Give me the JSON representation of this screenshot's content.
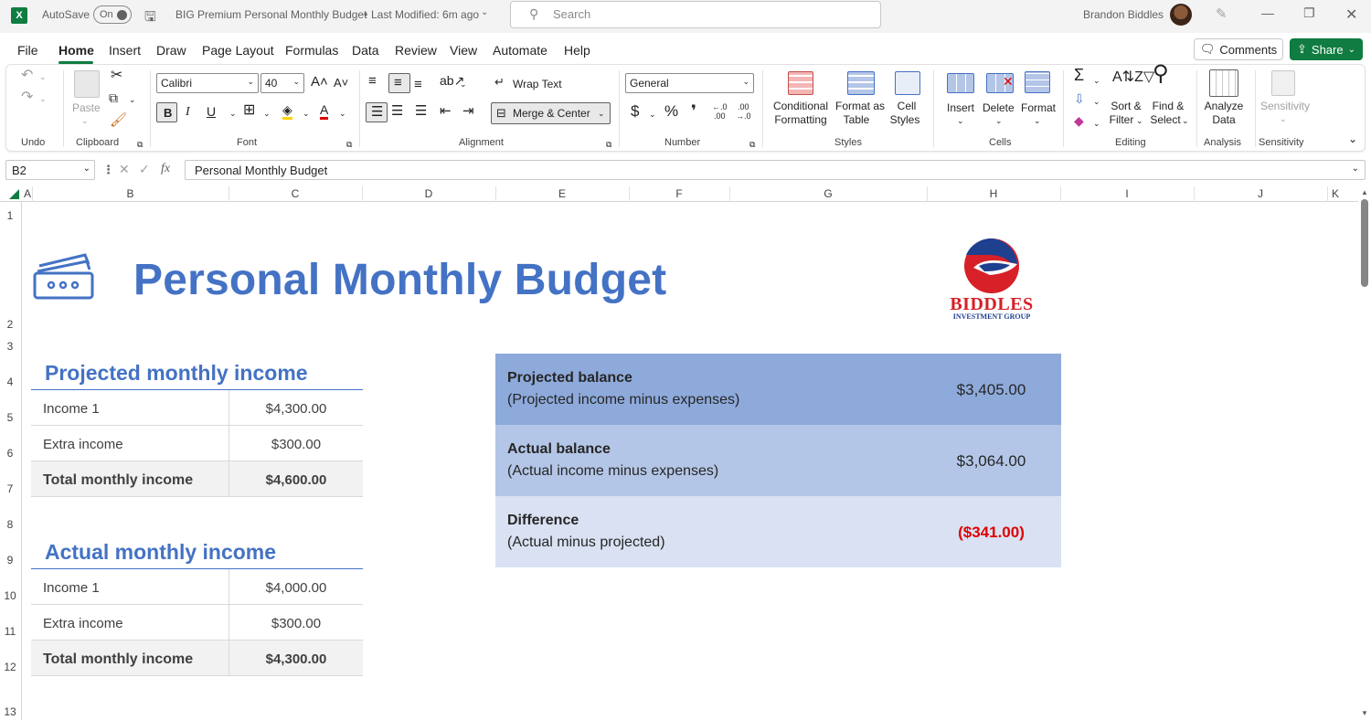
{
  "window": {
    "app_logo": "X",
    "autosave_label": "AutoSave",
    "autosave_state": "On",
    "doc_title": "BIG Premium Personal Monthly Budget",
    "modified": "Last Modified: 6m ago",
    "search_placeholder": "Search",
    "user_name": "Brandon Biddles"
  },
  "menu": {
    "items": [
      "File",
      "Home",
      "Insert",
      "Draw",
      "Page Layout",
      "Formulas",
      "Data",
      "Review",
      "View",
      "Automate",
      "Help"
    ],
    "active": "Home",
    "comments_label": "Comments",
    "share_label": "Share"
  },
  "ribbon": {
    "groups": {
      "undo": "Undo",
      "clipboard": "Clipboard",
      "font": "Font",
      "alignment": "Alignment",
      "number": "Number",
      "styles": "Styles",
      "cells": "Cells",
      "editing": "Editing",
      "analysis": "Analysis",
      "sensitivity": "Sensitivity"
    },
    "paste_label": "Paste",
    "font_name": "Calibri",
    "font_size": "40",
    "wrap_text_label": "Wrap Text",
    "merge_center_label": "Merge & Center",
    "number_format": "General",
    "conditional_formatting": [
      "Conditional",
      "Formatting"
    ],
    "format_as_table": [
      "Format as",
      "Table"
    ],
    "cell_styles": [
      "Cell",
      "Styles"
    ],
    "insert_label": "Insert",
    "delete_label": "Delete",
    "format_label": "Format",
    "sort_filter": [
      "Sort &",
      "Filter"
    ],
    "find_select": [
      "Find &",
      "Select"
    ],
    "analyze_data": [
      "Analyze",
      "Data"
    ],
    "sensitivity_label": "Sensitivity",
    "bold": "B",
    "italic": "I",
    "underline": "U",
    "currency": "$",
    "percent": "%",
    "comma": "❜",
    "inc_decimal": "←.0\n.00",
    "dec_decimal": ".00\n→.0"
  },
  "formula_bar": {
    "cell_ref": "B2",
    "fx": "fx",
    "content": "Personal Monthly Budget"
  },
  "grid": {
    "columns": [
      "A",
      "B",
      "C",
      "D",
      "E",
      "F",
      "G",
      "H",
      "I",
      "J",
      "K"
    ],
    "rows": [
      "1",
      "2",
      "3",
      "4",
      "5",
      "6",
      "7",
      "8",
      "9",
      "10",
      "11",
      "12",
      "13"
    ]
  },
  "sheet": {
    "title": "Personal Monthly Budget",
    "logo_name": "BIDDLES",
    "logo_sub": "INVESTMENT GROUP",
    "projected": {
      "heading": "Projected monthly income",
      "rows": [
        {
          "label": "Income 1",
          "value": "$4,300.00"
        },
        {
          "label": "Extra income",
          "value": "$300.00"
        }
      ],
      "total_label": "Total monthly income",
      "total_value": "$4,600.00"
    },
    "actual": {
      "heading": "Actual monthly income",
      "rows": [
        {
          "label": "Income 1",
          "value": "$4,000.00"
        },
        {
          "label": "Extra income",
          "value": "$300.00"
        }
      ],
      "total_label": "Total monthly income",
      "total_value": "$4,300.00"
    },
    "balances": [
      {
        "title": "Projected balance",
        "subtitle": "(Projected income minus expenses)",
        "amount": "$3,405.00",
        "color": "#8eaadb"
      },
      {
        "title": "Actual balance",
        "subtitle": "(Actual income minus expenses)",
        "amount": "$3,064.00",
        "color": "#b4c6e7"
      },
      {
        "title": "Difference",
        "subtitle": "(Actual minus projected)",
        "amount": "($341.00)",
        "color": "#d9e1f2"
      }
    ]
  },
  "colors": {
    "accent": "#107c41",
    "title_blue": "#4472c4",
    "negative": "#e00000"
  }
}
